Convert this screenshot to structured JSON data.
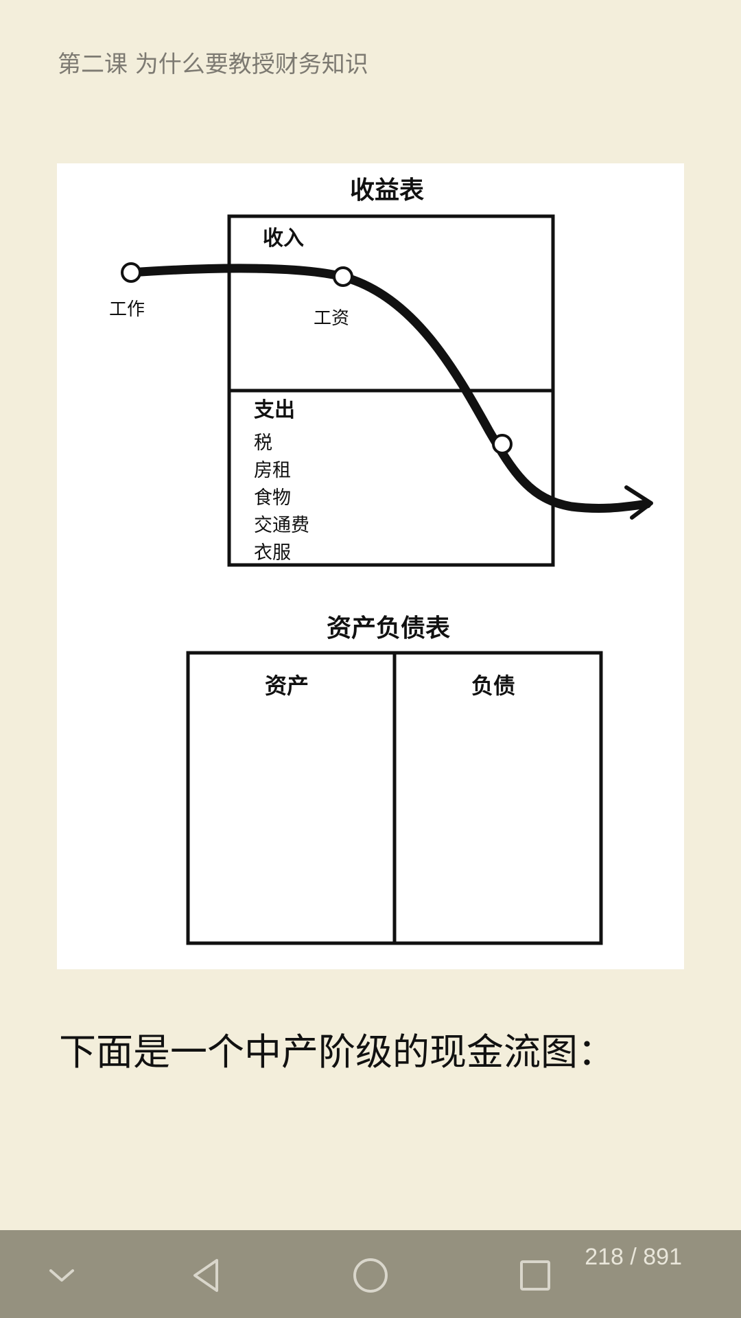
{
  "header": {
    "chapter_title": "第二课 为什么要教授财务知识"
  },
  "figure": {
    "income_statement": {
      "title": "收益表",
      "income_label": "收入",
      "work_label": "工作",
      "salary_label": "工资",
      "expense_label": "支出",
      "expenses": [
        "税",
        "房租",
        "食物",
        "交通费",
        "衣服"
      ]
    },
    "balance_sheet": {
      "title": "资产负债表",
      "assets_label": "资产",
      "liabilities_label": "负债"
    }
  },
  "body": {
    "text": "下面是一个中产阶级的现金流图："
  },
  "footer": {
    "page_counter": "218 / 891",
    "icons": [
      "chevron-down-icon",
      "back-triangle-icon",
      "home-circle-icon",
      "recents-square-icon"
    ],
    "bar_color": "#95917f"
  },
  "colors": {
    "background": "#f3eedb",
    "figure_background": "#ffffff"
  }
}
